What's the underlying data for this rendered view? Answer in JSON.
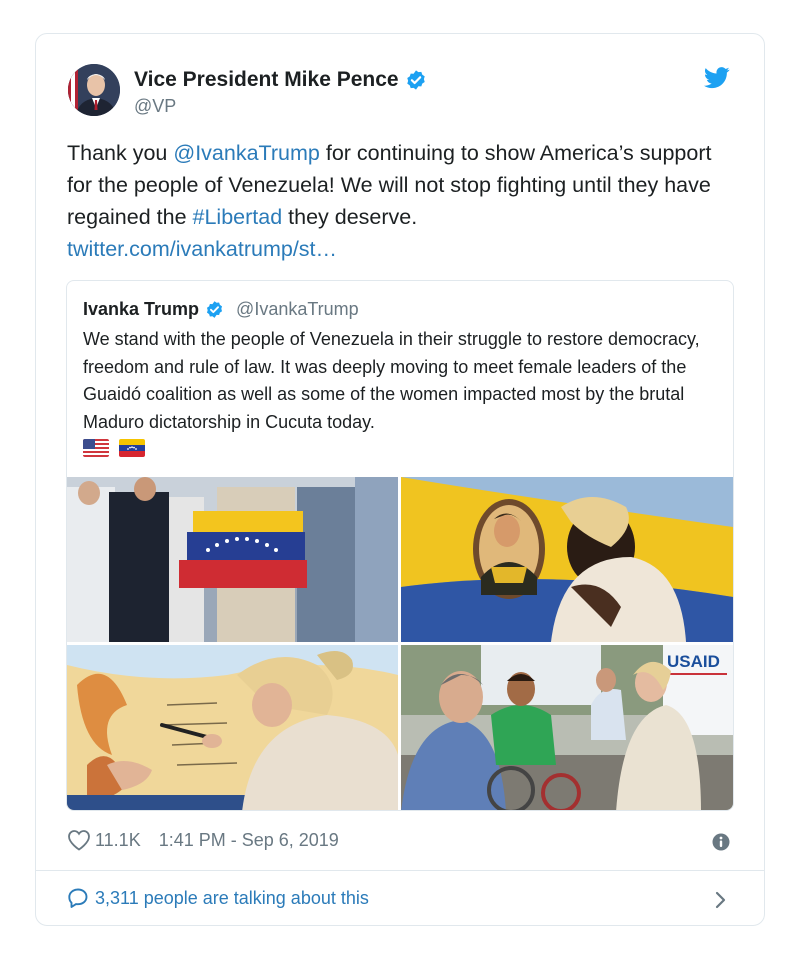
{
  "author": {
    "name": "Vice President Mike Pence",
    "handle": "@VP"
  },
  "icons": {
    "brand": "twitter-bird-icon",
    "verified": "verified-badge-icon",
    "like": "heart-icon",
    "info": "info-icon",
    "reply": "speech-bubble-icon",
    "more": "chevron-right-icon"
  },
  "colors": {
    "link": "#2b7bb9",
    "verified": "#1da1f2",
    "muted": "#697882"
  },
  "tweet": {
    "segments": [
      {
        "text": "Thank you ",
        "type": "text"
      },
      {
        "text": "@IvankaTrump",
        "type": "link"
      },
      {
        "text": " for continuing to show America’s support for the people of Venezuela! We will not stop fighting until they have regained the ",
        "type": "text"
      },
      {
        "text": "#Libertad",
        "type": "link"
      },
      {
        "text": " they deserve. ",
        "type": "text"
      },
      {
        "text": "twitter.com/ivankatrump/st…",
        "type": "link"
      }
    ]
  },
  "quoted": {
    "name": "Ivanka Trump",
    "handle": "@IvankaTrump",
    "text": "We stand with the people of Venezuela in their struggle to restore democracy, freedom and rule of law.  It was deeply moving to meet female leaders of the Guaidó coalition as well as some of the women impacted most by the brutal Maduro dictatorship in Cucuta today.",
    "flags": [
      "us-flag-emoji",
      "venezuela-flag-emoji"
    ],
    "photo_sign": "USAID"
  },
  "footer": {
    "likes": "11.1K",
    "timestamp": "1:41 PM - Sep 6, 2019",
    "talking": "3,311 people are talking about this"
  }
}
